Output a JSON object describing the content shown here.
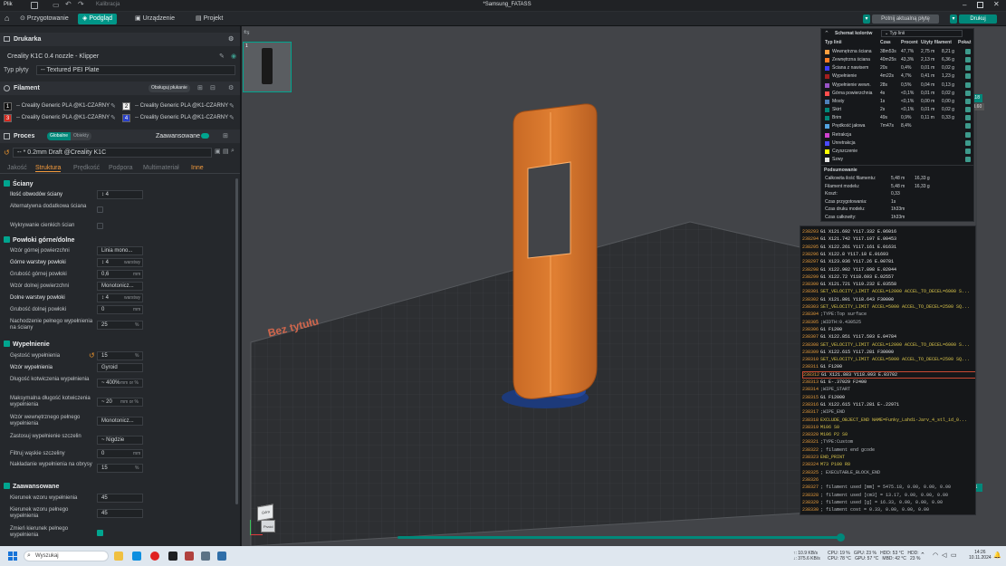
{
  "window": {
    "title": "*Samsung_FATASS",
    "menu_file": "Plik",
    "calibration": "Kalibracja"
  },
  "tabs": [
    {
      "label": "Przygotowanie"
    },
    {
      "label": "Podgląd",
      "active": true
    },
    {
      "label": "Urządzenie"
    },
    {
      "label": "Projekt"
    }
  ],
  "actions": {
    "slice": "Potnij aktualną płytę",
    "print": "Drukuj"
  },
  "printer": {
    "section": "Drukarka",
    "name": "Creality K1C 0.4 nozzle - Klipper",
    "plate_label": "Typ płyty",
    "plate_value": "Textured PEI Plate"
  },
  "filament": {
    "section": "Filament",
    "sync_button": "Obsługuj płukanie",
    "items": [
      {
        "num": "1",
        "name": "Creality Generic PLA @K1-CZARNY",
        "color": "#111111"
      },
      {
        "num": "2",
        "name": "Creality Generic PLA @K1-CZARNY",
        "color": "#eeeeee"
      },
      {
        "num": "3",
        "name": "Creality Generic PLA @K1-CZARNY",
        "color": "#d42a20"
      },
      {
        "num": "4",
        "name": "Creality Generic PLA @K1-CZARNY",
        "color": "#2940c8"
      }
    ]
  },
  "process": {
    "section": "Proces",
    "toggle_global": "Globalne",
    "toggle_object": "Obiekty",
    "advanced": "Zaawansowane",
    "preset": "* 0.2mm Draft @Creality K1C",
    "subtabs": [
      "Jakość",
      "Struktura",
      "Prędkość",
      "Podpora",
      "Multimateriał",
      "Inne"
    ]
  },
  "walls": {
    "header": "Ściany",
    "rows": [
      {
        "label": "Ilość obwodów ściany",
        "value": "4"
      },
      {
        "label": "Alternatywna dodatkowa ściana",
        "value": ""
      },
      {
        "label": "Wykrywanie cienkich ścian",
        "value": ""
      }
    ]
  },
  "shell": {
    "header": "Powłoki górne/dolne",
    "rows": [
      {
        "label": "Wzór górnej powierzchni",
        "value": "Linia mono..."
      },
      {
        "label": "Górne warstwy powłoki",
        "value": "4",
        "unit": "warstwy"
      },
      {
        "label": "Grubość górnej powłoki",
        "value": "0,6",
        "unit": "mm"
      },
      {
        "label": "Wzór dolnej powierzchni",
        "value": "Monotonicz..."
      },
      {
        "label": "Dolne warstwy powłoki",
        "value": "4",
        "unit": "warstwy"
      },
      {
        "label": "Grubość dolnej powłoki",
        "value": "0",
        "unit": "mm"
      },
      {
        "label": "Nachodzenie pełnego wypełnienia na ściany",
        "value": "25",
        "unit": "%"
      }
    ]
  },
  "infill": {
    "header": "Wypełnienie",
    "rows": [
      {
        "label": "Gęstość wypełnienia",
        "value": "15",
        "unit": "%"
      },
      {
        "label": "Wzór wypełnienia",
        "value": "Gyroid"
      },
      {
        "label": "Długość kotwiczenia wypełnienia",
        "value": "400%",
        "unit": "mm or %"
      },
      {
        "label": "Maksymalna długość kotwiczenia wypełnienia",
        "value": "20",
        "unit": "mm or %"
      },
      {
        "label": "Wzór wewnętrznego pełnego wypełnienia",
        "value": "Monotonicz..."
      },
      {
        "label": "Zastosuj wypełnienie szczelin",
        "value": "Nigdzie"
      },
      {
        "label": "Filtruj wąskie szczeliny",
        "value": "0",
        "unit": "mm"
      },
      {
        "label": "Nakładanie wypełnienia na obrysy",
        "value": "15",
        "unit": "%"
      }
    ]
  },
  "advanced": {
    "header": "Zaawansowane",
    "rows": [
      {
        "label": "Kierunek wzoru wypełnienia",
        "value": "45"
      },
      {
        "label": "Kierunek wzoru pełnego wypełnienia",
        "value": "45"
      },
      {
        "label": "Zmień kierunek pełnego wypełnienia",
        "value": ""
      }
    ]
  },
  "plate": {
    "label": "Bez tytułu"
  },
  "view": {
    "top": "Góra",
    "front": "Przód"
  },
  "legend": {
    "title": "Schemat kolorów",
    "dropdown": "Typ linii",
    "headers": [
      "Typ linii",
      "Czas",
      "Procent",
      "Użyty filament",
      "Pokaż"
    ],
    "rows": [
      {
        "name": "Wewnętrzna ściana",
        "time": "38m53s",
        "pct": "47,7%",
        "len": "2,75 m",
        "g": "8,21 g",
        "color": "#ff9f3f"
      },
      {
        "name": "Zewnętrzna ściana",
        "time": "40m25s",
        "pct": "43,3%",
        "len": "2,13 m",
        "g": "6,36 g",
        "color": "#ff7d26"
      },
      {
        "name": "Ściana z nawisem",
        "time": "20s",
        "pct": "0,4%",
        "len": "0,01 m",
        "g": "0,02 g",
        "color": "#3e3cff"
      },
      {
        "name": "Wypełnienie",
        "time": "4m22s",
        "pct": "4,7%",
        "len": "0,41 m",
        "g": "1,23 g",
        "color": "#a21f1f"
      },
      {
        "name": "Wypełnienie wewn.",
        "time": "28s",
        "pct": "0,5%",
        "len": "0,04 m",
        "g": "0,13 g",
        "color": "#9954c7"
      },
      {
        "name": "Górna powierzchnia",
        "time": "4s",
        "pct": "<0,1%",
        "len": "0,01 m",
        "g": "0,02 g",
        "color": "#ff4d4d"
      },
      {
        "name": "Mosty",
        "time": "1s",
        "pct": "<0,1%",
        "len": "0,00 m",
        "g": "0,00 g",
        "color": "#4d80ba"
      },
      {
        "name": "Skirt",
        "time": "2s",
        "pct": "<0,1%",
        "len": "0,01 m",
        "g": "0,02 g",
        "color": "#00877a"
      },
      {
        "name": "Brim",
        "time": "49s",
        "pct": "0,9%",
        "len": "0,11 m",
        "g": "0,33 g",
        "color": "#00877a"
      },
      {
        "name": "Prędkość jałowa",
        "time": "7m47s",
        "pct": "8,4%",
        "len": "",
        "g": "",
        "color": "#53a3e0"
      },
      {
        "name": "Retrakcja",
        "time": "",
        "pct": "",
        "len": "",
        "g": "",
        "color": "#d041d0"
      },
      {
        "name": "Unretrakcja",
        "time": "",
        "pct": "",
        "len": "",
        "g": "",
        "color": "#4a4aff"
      },
      {
        "name": "Czyszczenie",
        "time": "",
        "pct": "",
        "len": "",
        "g": "",
        "color": "#ffff00"
      },
      {
        "name": "Szwy",
        "time": "",
        "pct": "",
        "len": "",
        "g": "",
        "color": "#e6e6e6"
      }
    ],
    "summary_title": "Podsumowanie",
    "summary": [
      {
        "k": "Całkowita ilość filamentu:",
        "a": "5,48 m",
        "b": "16,33 g"
      },
      {
        "k": "Filament modelu:",
        "a": "5,48 m",
        "b": "16,33 g"
      },
      {
        "k": "Koszt:",
        "a": "0,33",
        "b": ""
      },
      {
        "k": "Czas przygotowania:",
        "a": "1s",
        "b": ""
      },
      {
        "k": "Czas druku modelu:",
        "a": "1h33m",
        "b": ""
      },
      {
        "k": "Czas całkowity:",
        "a": "1h33m",
        "b": ""
      }
    ]
  },
  "gcode": [
    {
      "n": "238293",
      "t": "G1 X121.692 Y117.332 E.06016"
    },
    {
      "n": "238294",
      "t": "G1 X121.742 Y117.197 E.00453"
    },
    {
      "n": "238295",
      "t": "G1 X122.261 Y117.161 E.01631"
    },
    {
      "n": "238296",
      "t": "G1 X122.8 Y117.18 E.01693"
    },
    {
      "n": "238297",
      "t": "G1 X123.036 Y117.26 E.00781"
    },
    {
      "n": "238298",
      "t": "G1 X122.902 Y117.898 E.02044"
    },
    {
      "n": "238299",
      "t": "G1 X122.72 Y118.693 E.02557"
    },
    {
      "n": "238300",
      "t": "G1 X121.721 Y119.232 E.03558"
    },
    {
      "n": "238301",
      "t": "SET_VELOCITY_LIMIT ACCEL=12000 ACCEL_TO_DECEL=6000 S..."
    },
    {
      "n": "238302",
      "t": "G1 X121.801 Y118.643 F30000"
    },
    {
      "n": "238303",
      "t": "SET_VELOCITY_LIMIT ACCEL=5000 ACCEL_TO_DECEL=2500 SQ..."
    },
    {
      "n": "238304",
      "t": ";TYPE:Top surface"
    },
    {
      "n": "238305",
      "t": ";WIDTH:0.430525"
    },
    {
      "n": "238306",
      "t": "G1 F1200"
    },
    {
      "n": "238307",
      "t": "G1 X122.851 Y117.593 E.04784"
    },
    {
      "n": "238308",
      "t": "SET_VELOCITY_LIMIT ACCEL=12000 ACCEL_TO_DECEL=6000 S..."
    },
    {
      "n": "238309",
      "t": "G1 X122.615 Y117.281 F30000"
    },
    {
      "n": "238310",
      "t": "SET_VELOCITY_LIMIT ACCEL=5000 ACCEL_TO_DECEL=2500 SQ..."
    },
    {
      "n": "238311",
      "t": "G1 F1200"
    },
    {
      "n": "238312",
      "t": "G1 X121.803 Y118.093 E.03702"
    },
    {
      "n": "238313",
      "t": "G1 E-.37029 F2400"
    },
    {
      "n": "238314",
      "t": ";WIPE_START"
    },
    {
      "n": "238315",
      "t": "G1 F12000"
    },
    {
      "n": "238316",
      "t": "G1 X122.615 Y117.281 E-.22971"
    },
    {
      "n": "238317",
      "t": ";WIPE_END"
    },
    {
      "n": "238318",
      "t": "EXCLUDE_OBJECT_END NAME=Funky_Lahdi-Jarv_4_stl_id_0..."
    },
    {
      "n": "238319",
      "t": "M106 S0"
    },
    {
      "n": "238320",
      "t": "M106 P2 S0"
    },
    {
      "n": "238321",
      "t": ";TYPE:Custom"
    },
    {
      "n": "238322",
      "t": "; filament end gcode"
    },
    {
      "n": "238323",
      "t": "END_PRINT"
    },
    {
      "n": "238324",
      "t": "M73 P100 R0"
    },
    {
      "n": "238325",
      "t": "; EXECUTABLE_BLOCK_END"
    },
    {
      "n": "238326",
      "t": ""
    },
    {
      "n": "238327",
      "t": "; filament used [mm] = 5475.18, 0.00, 0.00, 0.00"
    },
    {
      "n": "238328",
      "t": "; filament used [cm3] = 13.17, 0.00, 0.00, 0.00"
    },
    {
      "n": "238329",
      "t": "; filament used [g] = 16.33, 0.00, 0.00, 0.00"
    },
    {
      "n": "238330",
      "t": "; filament cost = 0.33, 0.00, 0.00, 0.00"
    }
  ],
  "highlight_line": "238312",
  "layers": {
    "top": "118",
    "top_h": "23.60",
    "bottom": "1",
    "bottom_h": "0.20"
  },
  "taskbar": {
    "search": "Wyszukaj",
    "net": "↑: 10.9 KB/s\n↓: 375.6 KB/s",
    "cpu": "CPU: 19 %   GPU: 23 %   HDD: 53 °C   HDD:\nCPU: 78 °C   GPU: 57 °C   MBD: 42 °C   23 %",
    "time": "14:26",
    "date": "10.11.2024"
  }
}
